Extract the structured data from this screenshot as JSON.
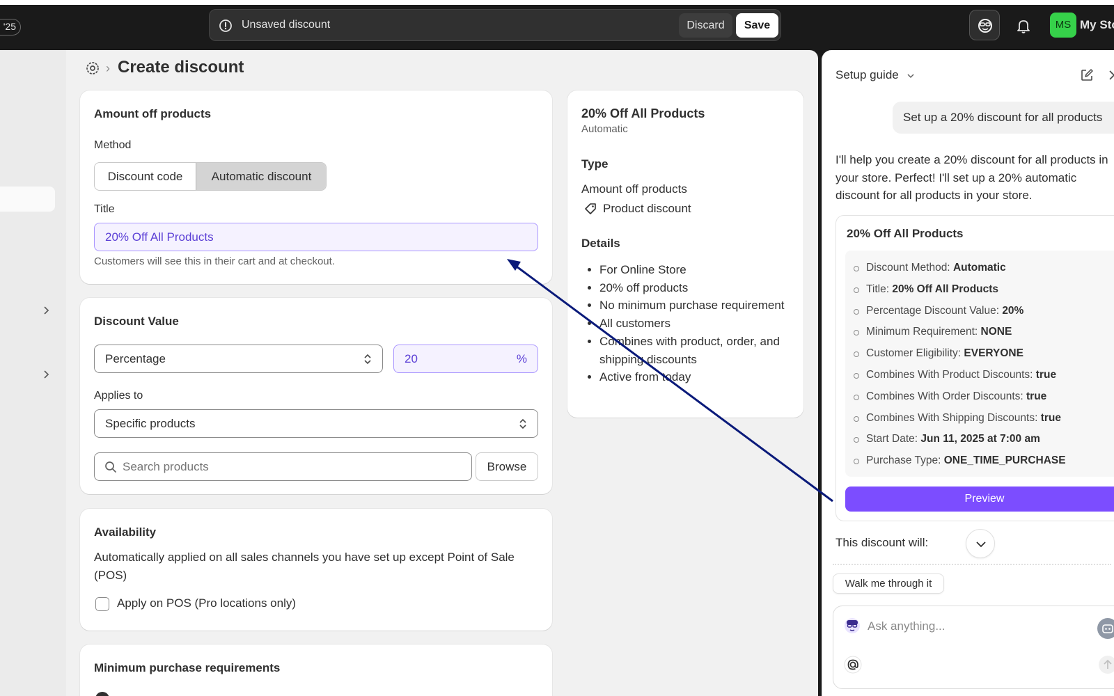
{
  "topbar": {
    "year_pill": "'25",
    "unsaved_text": "Unsaved discount",
    "discard_label": "Discard",
    "save_label": "Save",
    "avatar_initials": "MS",
    "store_name": "My Store",
    "avatar_color": "#36d14a"
  },
  "page": {
    "title": "Create discount",
    "breadcrumb_separator": "›"
  },
  "amount_card": {
    "title": "Amount off products",
    "method_label": "Method",
    "method_options": [
      "Discount code",
      "Automatic discount"
    ],
    "method_selected": "Automatic discount",
    "title_label": "Title",
    "title_value": "20% Off All Products",
    "title_help": "Customers will see this in their cart and at checkout."
  },
  "value_card": {
    "title": "Discount Value",
    "type_value": "Percentage",
    "amount_value": "20",
    "amount_suffix": "%",
    "applies_label": "Applies to",
    "applies_value": "Specific products",
    "search_placeholder": "Search products",
    "browse_label": "Browse"
  },
  "availability_card": {
    "title": "Availability",
    "text": "Automatically applied on all sales channels you have set up except Point of Sale (POS)",
    "pos_label": "Apply on POS (Pro locations only)",
    "pos_checked": false
  },
  "min_card": {
    "title": "Minimum purchase requirements"
  },
  "summary": {
    "title": "20% Off All Products",
    "subtitle": "Automatic",
    "type_heading": "Type",
    "type_value": "Amount off products",
    "type_tag": "Product discount",
    "details_heading": "Details",
    "details": [
      "For Online Store",
      "20% off products",
      "No minimum purchase requirement",
      "All customers",
      "Combines with product, order, and shipping discounts",
      "Active from today"
    ]
  },
  "panel": {
    "title": "Setup guide",
    "user_message": "Set up a 20% discount for all products",
    "reply": "I'll help you create a 20% discount for all products in your store. Perfect! I'll set up a 20% automatic discount for all products in your store.",
    "card_title": "20% Off All Products",
    "fields": [
      {
        "label": "Discount Method: ",
        "value": "Automatic"
      },
      {
        "label": "Title: ",
        "value": "20% Off All Products"
      },
      {
        "label": "Percentage Discount Value: ",
        "value": "20%"
      },
      {
        "label": "Minimum Requirement: ",
        "value": "NONE"
      },
      {
        "label": "Customer Eligibility: ",
        "value": "EVERYONE"
      },
      {
        "label": "Combines With Product Discounts: ",
        "value": "true"
      },
      {
        "label": "Combines With Order Discounts: ",
        "value": "true"
      },
      {
        "label": "Combines With Shipping Discounts: ",
        "value": "true"
      },
      {
        "label": "Start Date: ",
        "value": "Jun 11, 2025 at 7:00 am"
      },
      {
        "label": "Purchase Type: ",
        "value": "ONE_TIME_PURCHASE"
      }
    ],
    "preview_label": "Preview",
    "will_text": "This discount will:",
    "walk_label": "Walk me through it",
    "ask_placeholder": "Ask anything...",
    "accent_color": "#7c4dff"
  },
  "annotation": {
    "arrow_color": "#0a1a7a"
  }
}
